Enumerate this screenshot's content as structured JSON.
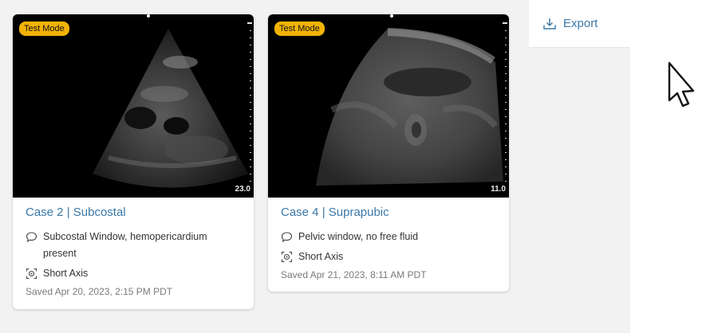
{
  "toolbar": {
    "export_label": "Export"
  },
  "cards": [
    {
      "badge": "Test Mode",
      "depth": "23.0",
      "title": "Case 2 | Subcostal",
      "comment": "Subcostal Window, hemopericardium present",
      "view": "Short Axis",
      "saved": "Saved Apr 20, 2023, 2:15 PM PDT"
    },
    {
      "badge": "Test Mode",
      "depth": "11.0",
      "title": "Case 4 | Suprapubic",
      "comment": "Pelvic window, no free fluid",
      "view": "Short Axis",
      "saved": "Saved Apr 21, 2023, 8:11 AM PDT"
    }
  ],
  "icons": {
    "export": "download-icon",
    "comment": "comment-icon",
    "view": "scan-view-icon",
    "cursor": "hand-pointer-icon"
  },
  "colors": {
    "accent": "#3a78a8",
    "badge": "#f2b305",
    "background": "#f2f2f2"
  }
}
